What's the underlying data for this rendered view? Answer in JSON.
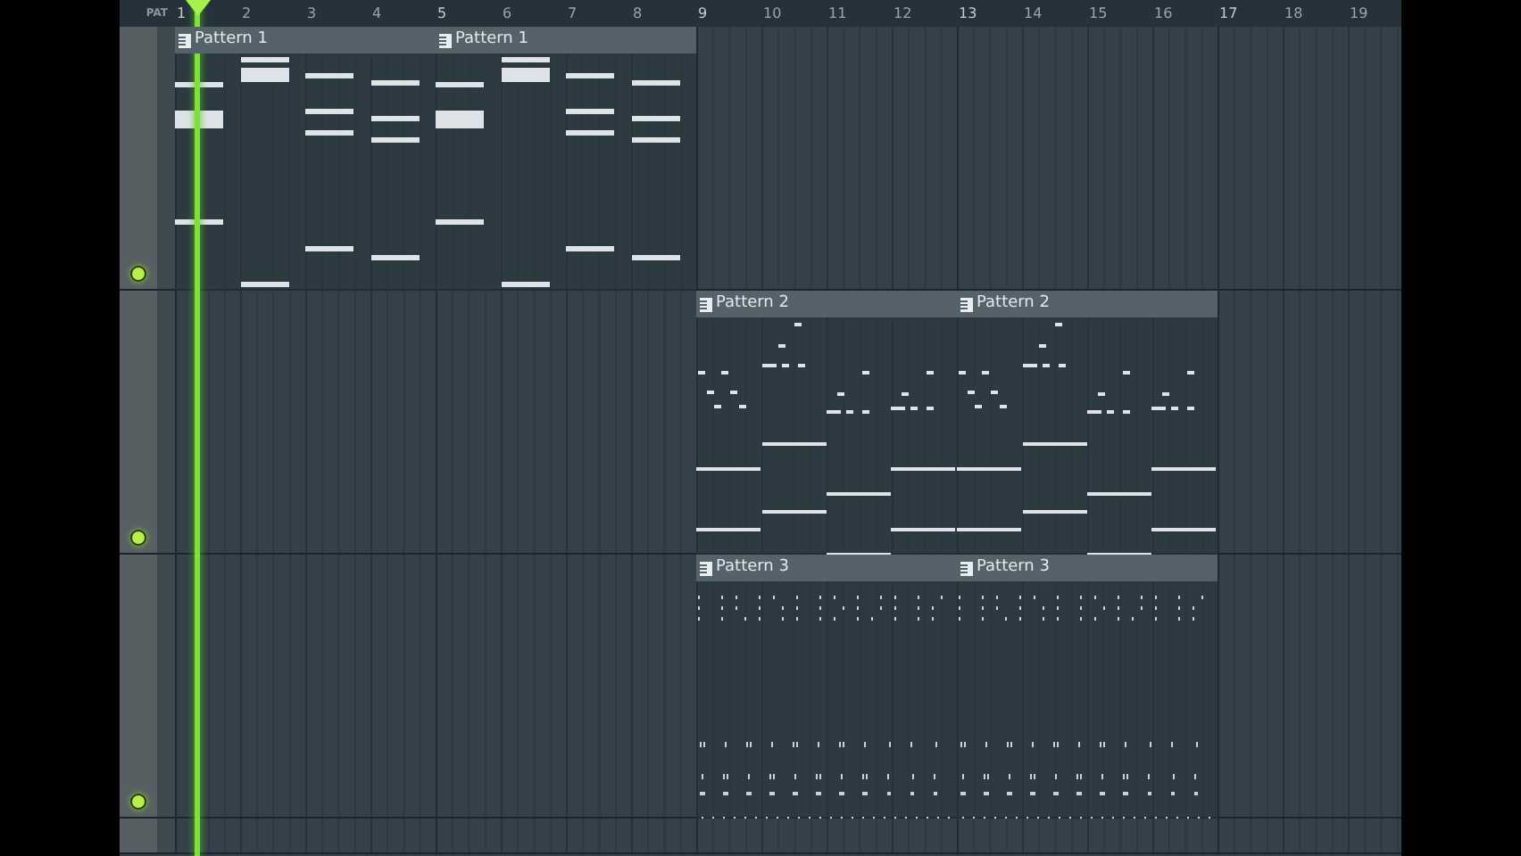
{
  "ruler": {
    "label": "PAT",
    "bars": [
      "1",
      "2",
      "3",
      "4",
      "5",
      "6",
      "7",
      "8",
      "9",
      "10",
      "11",
      "12",
      "13",
      "14",
      "15",
      "16",
      "17",
      "18",
      "19"
    ]
  },
  "tracks": [
    {
      "enabled": true,
      "clips": [
        {
          "title": "Pattern 1"
        },
        {
          "title": "Pattern 1"
        }
      ]
    },
    {
      "enabled": true,
      "clips": [
        {
          "title": "Pattern 2"
        },
        {
          "title": "Pattern 2"
        }
      ]
    },
    {
      "enabled": true,
      "clips": [
        {
          "title": "Pattern 3"
        },
        {
          "title": "Pattern 3"
        }
      ]
    }
  ]
}
